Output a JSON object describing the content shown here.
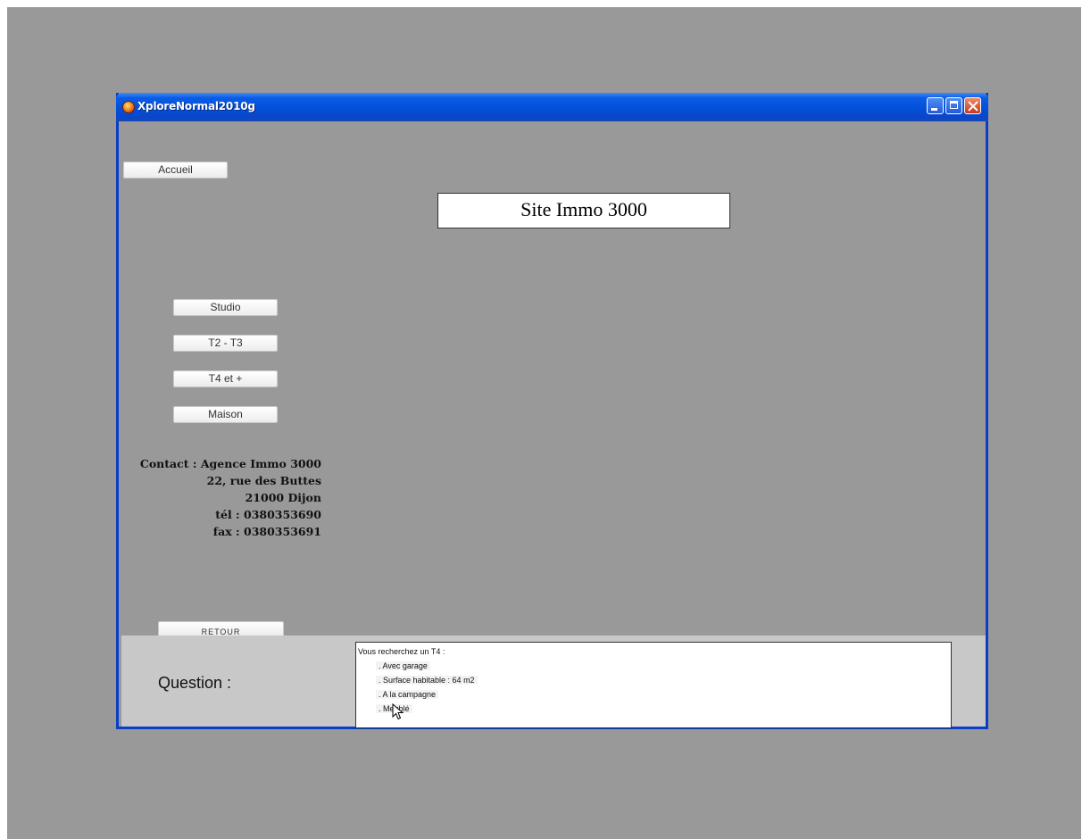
{
  "window": {
    "title": "XploreNormal2010g",
    "icon": "app-icon"
  },
  "nav": {
    "accueil_label": "Accueil",
    "studio_label": "Studio",
    "t2t3_label": "T2 - T3",
    "t4_label": "T4 et +",
    "maison_label": "Maison",
    "retour_label": "RETOUR"
  },
  "header": {
    "site_title": "Site Immo 3000"
  },
  "contact": {
    "line1": "Contact : Agence Immo 3000",
    "line2": "22, rue des Buttes",
    "line3": "21000 Dijon",
    "line4": "tél : 0380353690",
    "line5": "fax : 0380353691"
  },
  "question": {
    "label": "Question :",
    "intro": "Vous recherchez un T4 :",
    "items": [
      ". Avec garage",
      ". Surface habitable : 64 m2",
      ". A la campagne",
      ". Meublé"
    ]
  },
  "colors": {
    "background": "#999999",
    "titlebar": "#0350d8",
    "panel": "#c8c8c8"
  }
}
